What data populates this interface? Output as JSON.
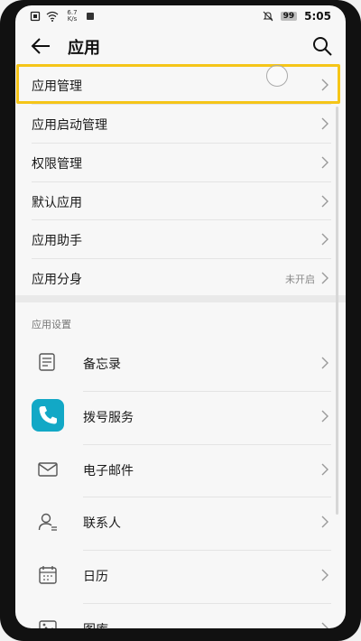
{
  "status_bar": {
    "net_speed_value": "6.7",
    "net_speed_unit": "K/s",
    "battery": "99",
    "time": "5:05"
  },
  "header": {
    "title": "应用",
    "back_icon": "back-arrow-icon",
    "search_icon": "search-icon"
  },
  "menu": {
    "items": [
      {
        "label": "应用管理",
        "sub": ""
      },
      {
        "label": "应用启动管理",
        "sub": ""
      },
      {
        "label": "权限管理",
        "sub": ""
      },
      {
        "label": "默认应用",
        "sub": ""
      },
      {
        "label": "应用助手",
        "sub": ""
      },
      {
        "label": "应用分身",
        "sub": "未开启"
      }
    ]
  },
  "app_settings": {
    "section_title": "应用设置",
    "apps": [
      {
        "label": "备忘录",
        "icon": "notepad-icon"
      },
      {
        "label": "拨号服务",
        "icon": "phone-icon"
      },
      {
        "label": "电子邮件",
        "icon": "mail-icon"
      },
      {
        "label": "联系人",
        "icon": "contacts-icon"
      },
      {
        "label": "日历",
        "icon": "calendar-icon"
      },
      {
        "label": "图库",
        "icon": "gallery-icon"
      }
    ]
  },
  "colors": {
    "highlight": "#f5c518",
    "phone_icon_bg": "#12a8c6"
  }
}
